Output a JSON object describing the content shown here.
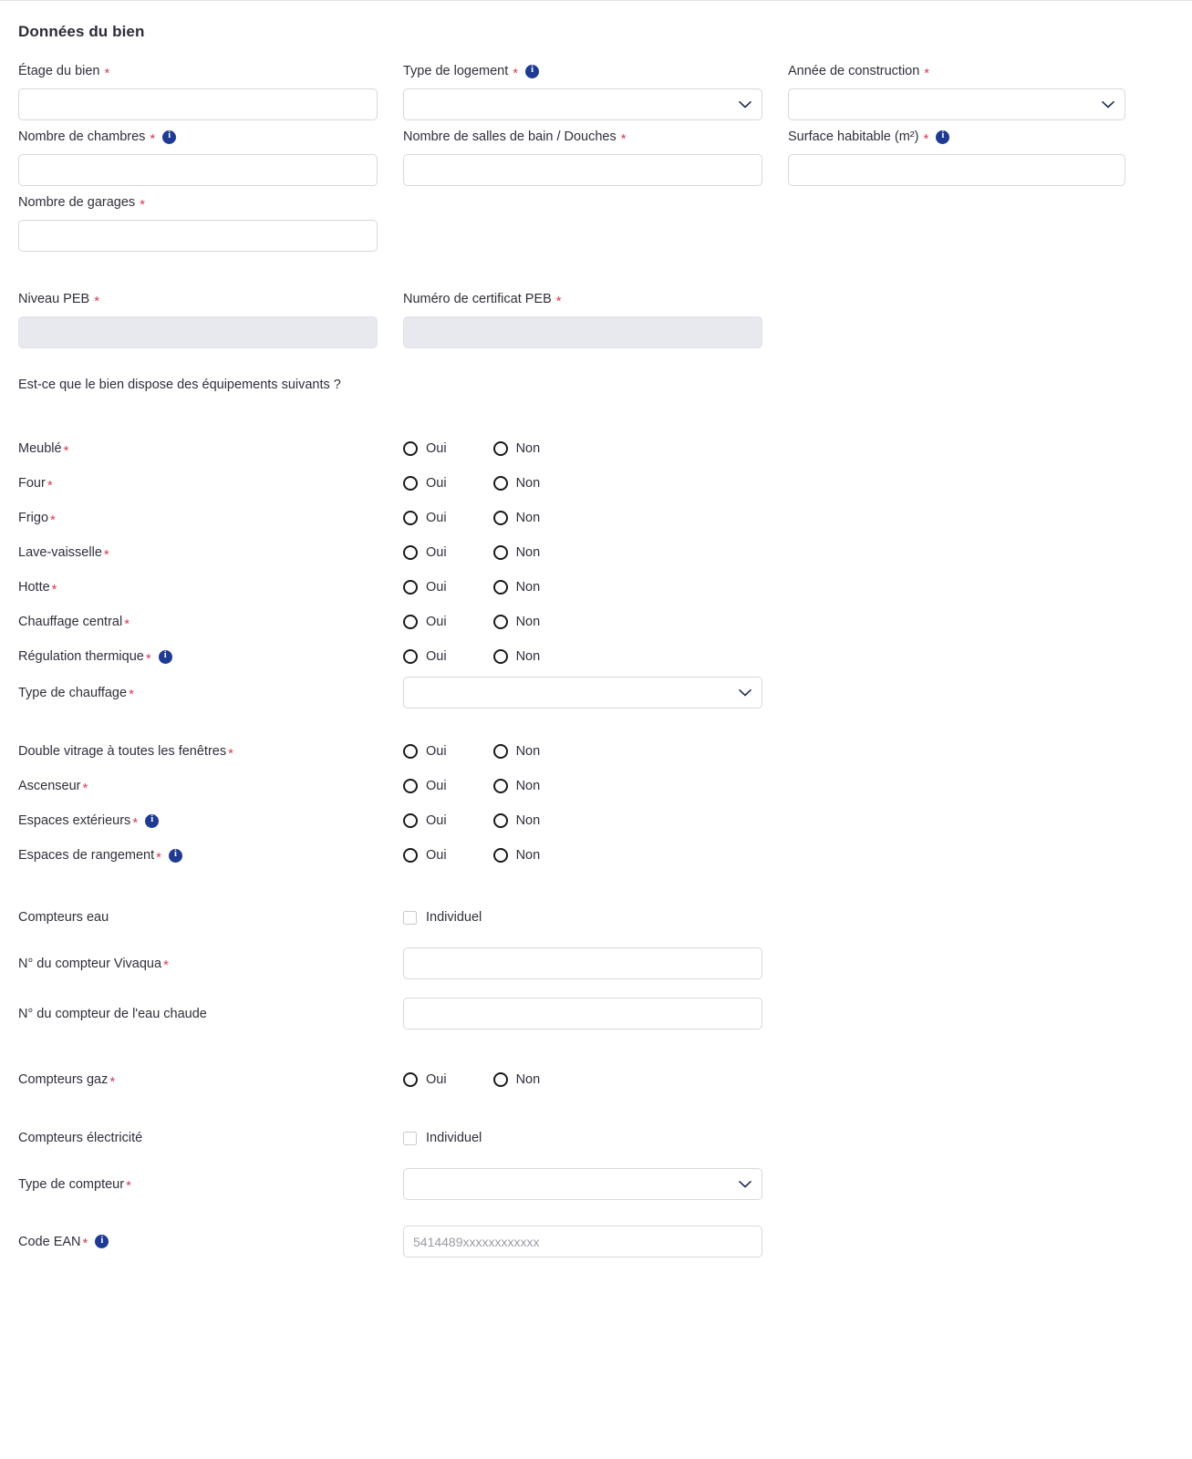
{
  "section": {
    "title": "Données du bien"
  },
  "fields": {
    "etage": {
      "label": "Étage du bien",
      "required": true,
      "value": "",
      "type": "text"
    },
    "type_logement": {
      "label": "Type de logement",
      "required": true,
      "info": true,
      "value": "",
      "type": "select"
    },
    "annee": {
      "label": "Année de construction",
      "required": true,
      "value": "",
      "type": "select"
    },
    "chambres": {
      "label": "Nombre de chambres",
      "required": true,
      "info": true,
      "value": "",
      "type": "text"
    },
    "sdb": {
      "label": "Nombre de salles de bain / Douches",
      "required": true,
      "value": "",
      "type": "text"
    },
    "surface": {
      "label": "Surface habitable (m²)",
      "required": true,
      "info": true,
      "value": "",
      "type": "text"
    },
    "garages": {
      "label": "Nombre de garages",
      "required": true,
      "value": "",
      "type": "text"
    },
    "niveau_peb": {
      "label": "Niveau PEB",
      "required": true,
      "value": "",
      "type": "text",
      "disabled": true
    },
    "numero_peb": {
      "label": "Numéro de certificat PEB",
      "required": true,
      "value": "",
      "type": "text",
      "disabled": true
    }
  },
  "equipments": {
    "question": "Est-ce que le bien dispose des équipements suivants ?",
    "yes_label": "Oui",
    "no_label": "Non",
    "group_a": [
      {
        "label": "Meublé",
        "required": true,
        "info": false
      },
      {
        "label": "Four",
        "required": true,
        "info": false
      },
      {
        "label": "Frigo",
        "required": true,
        "info": false
      },
      {
        "label": "Lave-vaisselle",
        "required": true,
        "info": false
      },
      {
        "label": "Hotte",
        "required": true,
        "info": false
      },
      {
        "label": "Chauffage central",
        "required": true,
        "info": false
      },
      {
        "label": "Régulation thermique",
        "required": true,
        "info": true
      }
    ],
    "type_chauffage": {
      "label": "Type de chauffage",
      "required": true,
      "value": "",
      "type": "select"
    },
    "group_b": [
      {
        "label": "Double vitrage à toutes les fenêtres",
        "required": true,
        "info": false
      },
      {
        "label": "Ascenseur",
        "required": true,
        "info": false
      },
      {
        "label": "Espaces extérieurs",
        "required": true,
        "info": true
      },
      {
        "label": "Espaces de rangement",
        "required": true,
        "info": true
      }
    ]
  },
  "meters": {
    "individual_label": "Individuel",
    "water": {
      "label": "Compteurs eau",
      "required": false,
      "checked": false
    },
    "vivaqua": {
      "label": "N° du compteur Vivaqua",
      "required": true,
      "value": "",
      "placeholder": ""
    },
    "hot_water": {
      "label": "N° du compteur de l'eau chaude",
      "required": false,
      "value": "",
      "placeholder": ""
    },
    "gas": {
      "label": "Compteurs gaz",
      "required": true,
      "yes_label": "Oui",
      "no_label": "Non"
    },
    "electricity": {
      "label": "Compteurs électricité",
      "required": false,
      "checked": false
    },
    "meter_type": {
      "label": "Type de compteur",
      "required": true,
      "value": "",
      "type": "select"
    },
    "ean": {
      "label": "Code EAN",
      "required": true,
      "info": true,
      "value": "",
      "placeholder": "5414489xxxxxxxxxxxx"
    }
  },
  "colors": {
    "required_asterisk": "#d13f5a",
    "info_badge": "#1f3a93",
    "border": "#d8d8de",
    "disabled_bg": "#e8e8ef",
    "text": "#2f2f3b",
    "chevron": "#1f2b50"
  }
}
